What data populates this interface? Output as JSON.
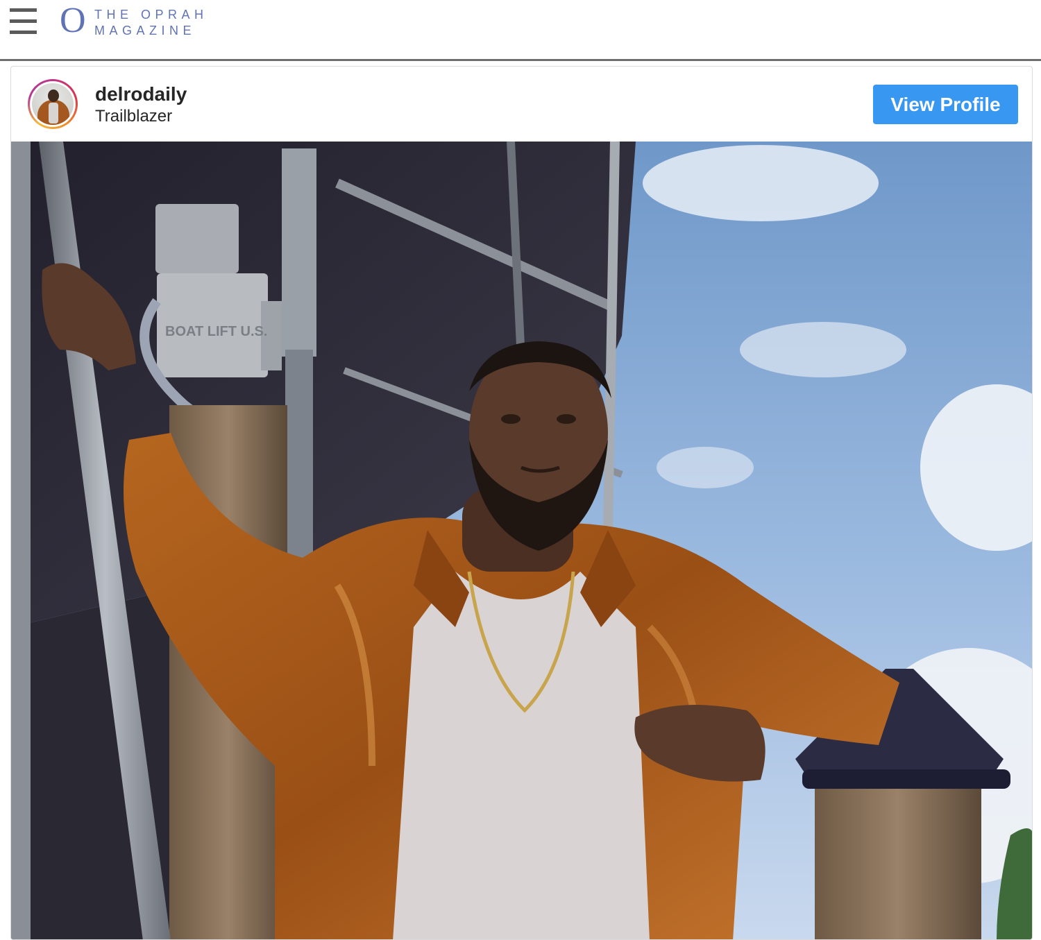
{
  "site": {
    "menu_icon": "hamburger-menu-icon",
    "logo": {
      "mark": "O",
      "line1": "THE OPRAH",
      "line2": "MAGAZINE",
      "color": "#5f73b5"
    }
  },
  "embed": {
    "username": "delrodaily",
    "subtitle": "Trailblazer",
    "view_profile_label": "View Profile",
    "button_color": "#3897f0",
    "photo": {
      "alt_icon": "photo",
      "sign_text": "BOAT LIFT U.S."
    }
  }
}
